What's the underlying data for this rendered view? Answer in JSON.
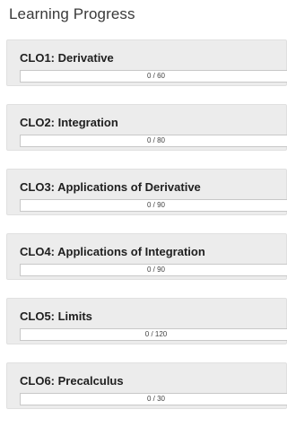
{
  "page": {
    "title": "Learning Progress"
  },
  "colors": {
    "card_background": "#ececec",
    "progress_background": "#ffffff",
    "progress_fill": "#4a90d9"
  },
  "outcomes": [
    {
      "title": "CLO1: Derivative",
      "progress_text": "0 / 60",
      "completed": 0,
      "total": 60
    },
    {
      "title": "CLO2: Integration",
      "progress_text": "0 / 80",
      "completed": 0,
      "total": 80
    },
    {
      "title": "CLO3: Applications of Derivative",
      "progress_text": "0 / 90",
      "completed": 0,
      "total": 90
    },
    {
      "title": "CLO4: Applications of Integration",
      "progress_text": "0 / 90",
      "completed": 0,
      "total": 90
    },
    {
      "title": "CLO5: Limits",
      "progress_text": "0 / 120",
      "completed": 0,
      "total": 120
    },
    {
      "title": "CLO6: Precalculus",
      "progress_text": "0 / 30",
      "completed": 0,
      "total": 30
    }
  ]
}
